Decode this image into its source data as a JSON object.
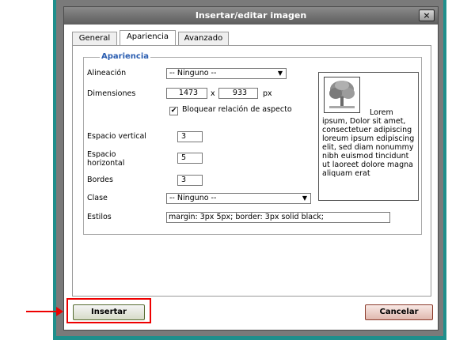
{
  "dialog": {
    "title": "Insertar/editar imagen",
    "close_symbol": "×"
  },
  "tabs": [
    {
      "label": "General"
    },
    {
      "label": "Apariencia"
    },
    {
      "label": "Avanzado"
    }
  ],
  "appearance": {
    "legend": "Apariencia",
    "alignment": {
      "label": "Alineación",
      "value": "-- Ninguno --"
    },
    "dimensions": {
      "label": "Dimensiones",
      "width": "1473",
      "separator": "x",
      "height": "933",
      "unit": "px"
    },
    "lock_ratio": {
      "label": "Bloquear relación de aspecto",
      "checked": true
    },
    "vspace": {
      "label": "Espacio vertical",
      "value": "3"
    },
    "hspace": {
      "label": "Espacio horizontal",
      "value": "5"
    },
    "border": {
      "label": "Bordes",
      "value": "3"
    },
    "class": {
      "label": "Clase",
      "value": "-- Ninguno --"
    },
    "styles": {
      "label": "Estilos",
      "value": "margin: 3px 5px; border: 3px solid black;"
    }
  },
  "preview": {
    "text": "Lorem ipsum, Dolor sit amet, consectetuer adipiscing loreum ipsum edipiscing elit, sed diam nonummy nibh euismod tincidunt ut laoreet dolore magna aliquam erat",
    "thumbnail_icon": "tree-image-icon"
  },
  "buttons": {
    "insert": "Insertar",
    "cancel": "Cancelar"
  },
  "annotation": {
    "color": "#e00000"
  }
}
